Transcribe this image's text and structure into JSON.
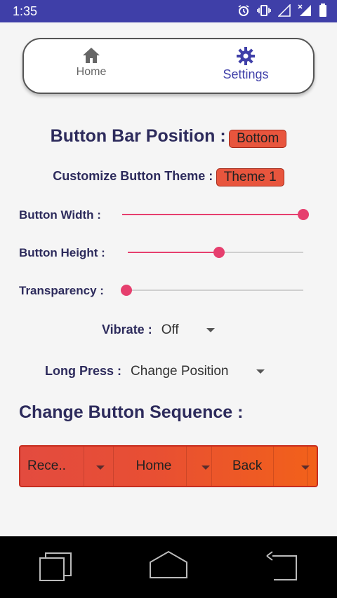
{
  "status_bar": {
    "time": "1:35"
  },
  "top_nav": {
    "items": [
      {
        "label": "Home",
        "icon": "home-icon"
      },
      {
        "label": "Settings",
        "icon": "gear-icon",
        "active": true
      }
    ]
  },
  "settings": {
    "bar_position": {
      "label": "Button Bar Position :",
      "value": "Bottom"
    },
    "theme": {
      "label": "Customize Button Theme :",
      "value": "Theme 1"
    },
    "button_width": {
      "label": "Button Width :",
      "value": 1.0
    },
    "button_height": {
      "label": "Button Height :",
      "value": 0.52
    },
    "transparency": {
      "label": "Transparency :",
      "value": 0.0
    },
    "vibrate": {
      "label": "Vibrate :",
      "value": "Off"
    },
    "long_press": {
      "label": "Long Press :",
      "value": "Change Position"
    }
  },
  "sequence": {
    "title": "Change Button Sequence :",
    "items": [
      "Rece..",
      "Home",
      "Back"
    ]
  },
  "colors": {
    "accent": "#3f3fa8",
    "slider": "#e63f6e",
    "chip": "#e8553d",
    "text_dark": "#2d2b5c"
  },
  "system_nav": {
    "icons": [
      "recents-icon",
      "home-button-icon",
      "back-icon"
    ]
  }
}
